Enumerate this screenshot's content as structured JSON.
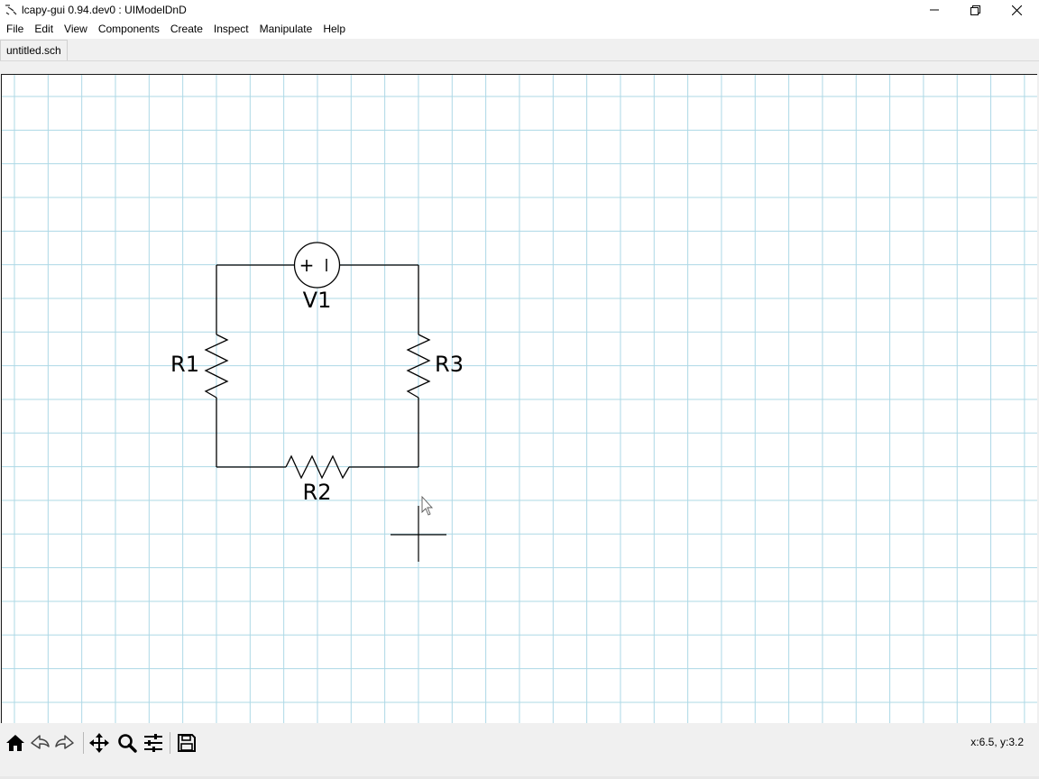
{
  "window": {
    "title": "lcapy-gui 0.94.dev0 : UIModelDnD",
    "controls": [
      "minimize-icon",
      "maximize-icon",
      "close-icon"
    ]
  },
  "menubar": {
    "items": [
      "File",
      "Edit",
      "View",
      "Components",
      "Create",
      "Inspect",
      "Manipulate",
      "Help"
    ]
  },
  "tabs": [
    {
      "label": "untitled.sch",
      "active": true
    }
  ],
  "schematic": {
    "components": [
      {
        "name": "V1",
        "type": "voltage-source",
        "symbol_text": "+ I"
      },
      {
        "name": "R1",
        "type": "resistor"
      },
      {
        "name": "R2",
        "type": "resistor"
      },
      {
        "name": "R3",
        "type": "resistor"
      }
    ],
    "grid_color": "#add8e6",
    "wire_color": "#000000"
  },
  "toolbar": {
    "buttons": [
      {
        "icon": "home-icon"
      },
      {
        "icon": "back-arrow-icon"
      },
      {
        "icon": "forward-arrow-icon"
      },
      {
        "icon": "pan-icon"
      },
      {
        "icon": "zoom-icon"
      },
      {
        "icon": "configure-subplots-icon"
      },
      {
        "icon": "save-icon"
      }
    ]
  },
  "status": {
    "coordinates": "x:6.5, y:3.2"
  }
}
